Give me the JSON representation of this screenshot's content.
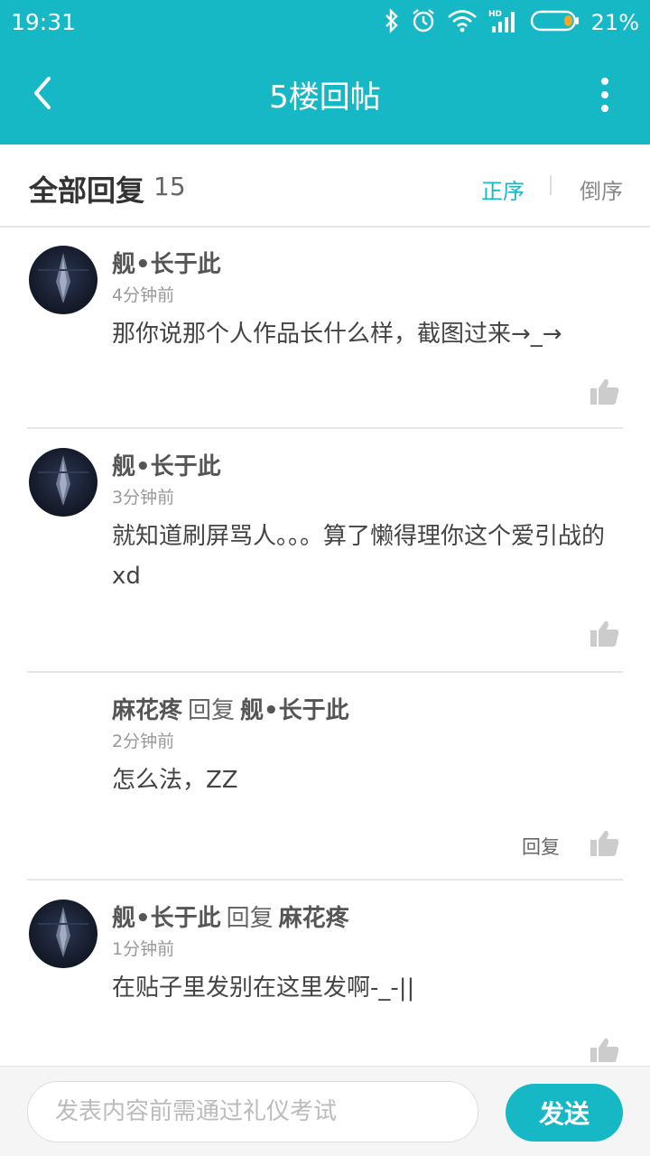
{
  "status": {
    "time": "19:31",
    "battery_pct": "21%",
    "icons": [
      "bluetooth-icon",
      "alarm-icon",
      "wifi-icon",
      "hd-signal-icon",
      "battery-icon"
    ]
  },
  "appbar": {
    "title": "5楼回帖",
    "back_icon": "back-arrow-icon",
    "more_icon": "more-vertical-icon"
  },
  "section": {
    "title": "全部回复",
    "count": "15",
    "sort_asc": "正序",
    "sort_desc": "倒序"
  },
  "replies": [
    {
      "author": "舰•长于此",
      "reply_word": "",
      "reply_to": "",
      "time": "4分钟前",
      "content": "那你说那个人作品长什么样，截图过来→_→",
      "has_avatar": true,
      "reply_link": ""
    },
    {
      "author": "舰•长于此",
      "reply_word": "",
      "reply_to": "",
      "time": "3分钟前",
      "content": "就知道刷屏骂人。。。算了懒得理你这个爱引战的xd",
      "has_avatar": true,
      "reply_link": ""
    },
    {
      "author": "麻花疼",
      "reply_word": "回复",
      "reply_to": "舰•长于此",
      "time": "2分钟前",
      "content": "怎么法，ZZ",
      "has_avatar": false,
      "reply_link": "回复"
    },
    {
      "author": "舰•长于此",
      "reply_word": "回复",
      "reply_to": "麻花疼",
      "time": "1分钟前",
      "content": "在贴子里发别在这里发啊-_-||",
      "has_avatar": true,
      "reply_link": ""
    }
  ],
  "composer": {
    "placeholder": "发表内容前需通过礼仪考试",
    "send_label": "发送"
  },
  "colors": {
    "accent": "#16b8c6",
    "like_icon": "#cccccc"
  }
}
